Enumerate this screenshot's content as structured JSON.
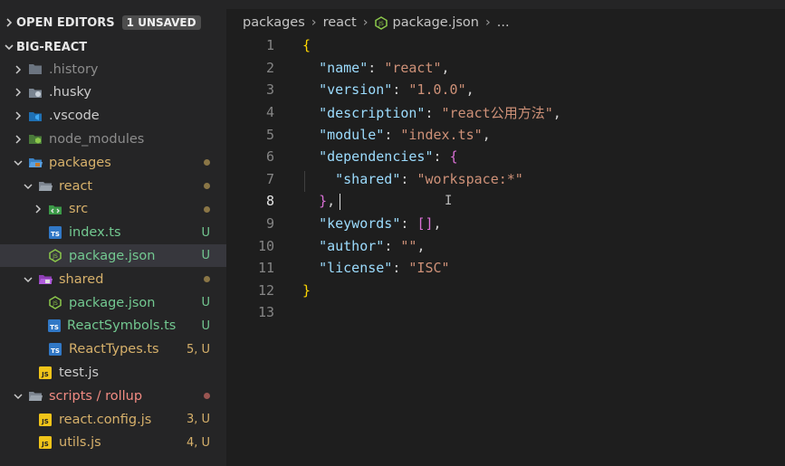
{
  "sidebar": {
    "open_editors": {
      "label": "OPEN EDITORS",
      "badge": "1 UNSAVED"
    },
    "project": {
      "label": "BIG-REACT"
    },
    "tree": [
      {
        "label": ".history",
        "chevron": "right",
        "icon": "folder-icon",
        "name": "tree-item-history",
        "color": "dim",
        "status": ""
      },
      {
        "label": ".husky",
        "chevron": "right",
        "icon": "husky-folder-icon",
        "name": "tree-item-husky",
        "color": "plain",
        "status": ""
      },
      {
        "label": ".vscode",
        "chevron": "right",
        "icon": "vscode-folder-icon",
        "name": "tree-item-vscode",
        "color": "plain",
        "status": ""
      },
      {
        "label": "node_modules",
        "chevron": "right",
        "icon": "node-folder-icon",
        "name": "tree-item-node-modules",
        "color": "dim",
        "status": ""
      },
      {
        "label": "packages",
        "chevron": "down",
        "icon": "packages-folder-icon",
        "name": "tree-item-packages",
        "color": "mod",
        "status": "dot-mod"
      },
      {
        "label": "react",
        "chevron": "down",
        "icon": "folder-open-icon",
        "name": "tree-item-react",
        "color": "mod",
        "status": "dot-mod"
      },
      {
        "label": "src",
        "chevron": "right",
        "icon": "src-folder-icon",
        "name": "tree-item-src",
        "color": "mod",
        "status": "dot-mod"
      },
      {
        "label": "index.ts",
        "chevron": "",
        "icon": "typescript-file-icon",
        "name": "tree-item-index-ts",
        "color": "new",
        "status": "U"
      },
      {
        "label": "package.json",
        "chevron": "",
        "icon": "nodejs-file-icon",
        "name": "tree-item-react-package-json",
        "color": "new",
        "status": "U",
        "selected": true
      },
      {
        "label": "shared",
        "chevron": "down",
        "icon": "shared-folder-icon",
        "name": "tree-item-shared",
        "color": "mod",
        "status": "dot-mod"
      },
      {
        "label": "package.json",
        "chevron": "",
        "icon": "nodejs-file-icon",
        "name": "tree-item-shared-package-json",
        "color": "new",
        "status": "U"
      },
      {
        "label": "ReactSymbols.ts",
        "chevron": "",
        "icon": "typescript-file-icon",
        "name": "tree-item-react-symbols-ts",
        "color": "new",
        "status": "U"
      },
      {
        "label": "ReactTypes.ts",
        "chevron": "",
        "icon": "typescript-file-icon",
        "name": "tree-item-react-types-ts",
        "color": "mod",
        "status": "5, U"
      },
      {
        "label": "test.js",
        "chevron": "",
        "icon": "javascript-file-icon",
        "name": "tree-item-test-js",
        "color": "plain",
        "status": ""
      },
      {
        "label": "scripts / rollup",
        "chevron": "down",
        "icon": "folder-open-icon",
        "name": "tree-item-scripts-rollup",
        "color": "err",
        "status": "dot-err"
      },
      {
        "label": "react.config.js",
        "chevron": "",
        "icon": "javascript-file-icon",
        "name": "tree-item-react-config-js",
        "color": "mod",
        "status": "3, U"
      },
      {
        "label": "utils.js",
        "chevron": "",
        "icon": "javascript-file-icon",
        "name": "tree-item-utils-js",
        "color": "mod",
        "status": "4, U"
      }
    ]
  },
  "editor": {
    "breadcrumb": [
      "packages",
      "react",
      "package.json",
      "..."
    ],
    "active_line": 8,
    "lines": [
      {
        "n": "1",
        "tokens": [
          {
            "t": "{",
            "c": "brace"
          }
        ]
      },
      {
        "n": "2",
        "tokens": [
          {
            "t": "  "
          },
          {
            "t": "\"name\"",
            "c": "key"
          },
          {
            "t": ": ",
            "c": "punct"
          },
          {
            "t": "\"react\"",
            "c": "str"
          },
          {
            "t": ",",
            "c": "punct"
          }
        ]
      },
      {
        "n": "3",
        "tokens": [
          {
            "t": "  "
          },
          {
            "t": "\"version\"",
            "c": "key"
          },
          {
            "t": ": ",
            "c": "punct"
          },
          {
            "t": "\"1.0.0\"",
            "c": "str"
          },
          {
            "t": ",",
            "c": "punct"
          }
        ]
      },
      {
        "n": "4",
        "tokens": [
          {
            "t": "  "
          },
          {
            "t": "\"description\"",
            "c": "key"
          },
          {
            "t": ": ",
            "c": "punct"
          },
          {
            "t": "\"react公用方法\"",
            "c": "str"
          },
          {
            "t": ",",
            "c": "punct"
          }
        ]
      },
      {
        "n": "5",
        "tokens": [
          {
            "t": "  "
          },
          {
            "t": "\"module\"",
            "c": "key"
          },
          {
            "t": ": ",
            "c": "punct"
          },
          {
            "t": "\"index.ts\"",
            "c": "str"
          },
          {
            "t": ",",
            "c": "punct"
          }
        ]
      },
      {
        "n": "6",
        "tokens": [
          {
            "t": "  "
          },
          {
            "t": "\"dependencies\"",
            "c": "key"
          },
          {
            "t": ": ",
            "c": "punct"
          },
          {
            "t": "{",
            "c": "brace2"
          }
        ]
      },
      {
        "n": "7",
        "tokens": [
          {
            "t": "    "
          },
          {
            "t": "\"shared\"",
            "c": "key"
          },
          {
            "t": ": ",
            "c": "punct"
          },
          {
            "t": "\"workspace:*\"",
            "c": "str"
          }
        ]
      },
      {
        "n": "8",
        "tokens": [
          {
            "t": "  "
          },
          {
            "t": "}",
            "c": "brace2"
          },
          {
            "t": ",",
            "c": "punct"
          }
        ]
      },
      {
        "n": "9",
        "tokens": [
          {
            "t": "  "
          },
          {
            "t": "\"keywords\"",
            "c": "key"
          },
          {
            "t": ": ",
            "c": "punct"
          },
          {
            "t": "[]",
            "c": "brace2"
          },
          {
            "t": ",",
            "c": "punct"
          }
        ]
      },
      {
        "n": "10",
        "tokens": [
          {
            "t": "  "
          },
          {
            "t": "\"author\"",
            "c": "key"
          },
          {
            "t": ": ",
            "c": "punct"
          },
          {
            "t": "\"\"",
            "c": "str"
          },
          {
            "t": ",",
            "c": "punct"
          }
        ]
      },
      {
        "n": "11",
        "tokens": [
          {
            "t": "  "
          },
          {
            "t": "\"license\"",
            "c": "key"
          },
          {
            "t": ": ",
            "c": "punct"
          },
          {
            "t": "\"ISC\"",
            "c": "str"
          }
        ]
      },
      {
        "n": "12",
        "tokens": [
          {
            "t": "}",
            "c": "brace"
          }
        ]
      },
      {
        "n": "13",
        "tokens": []
      }
    ]
  },
  "colors": {
    "sidebar_bg": "#252526",
    "editor_bg": "#1e1e1e",
    "selected_row": "#37373d",
    "untracked": "#73c991",
    "modified": "#d7b16b",
    "error": "#f28b82",
    "json_key": "#9cdcfe",
    "json_string": "#ce9178",
    "brace": "#ffd700",
    "brace_nested": "#da70d6"
  }
}
